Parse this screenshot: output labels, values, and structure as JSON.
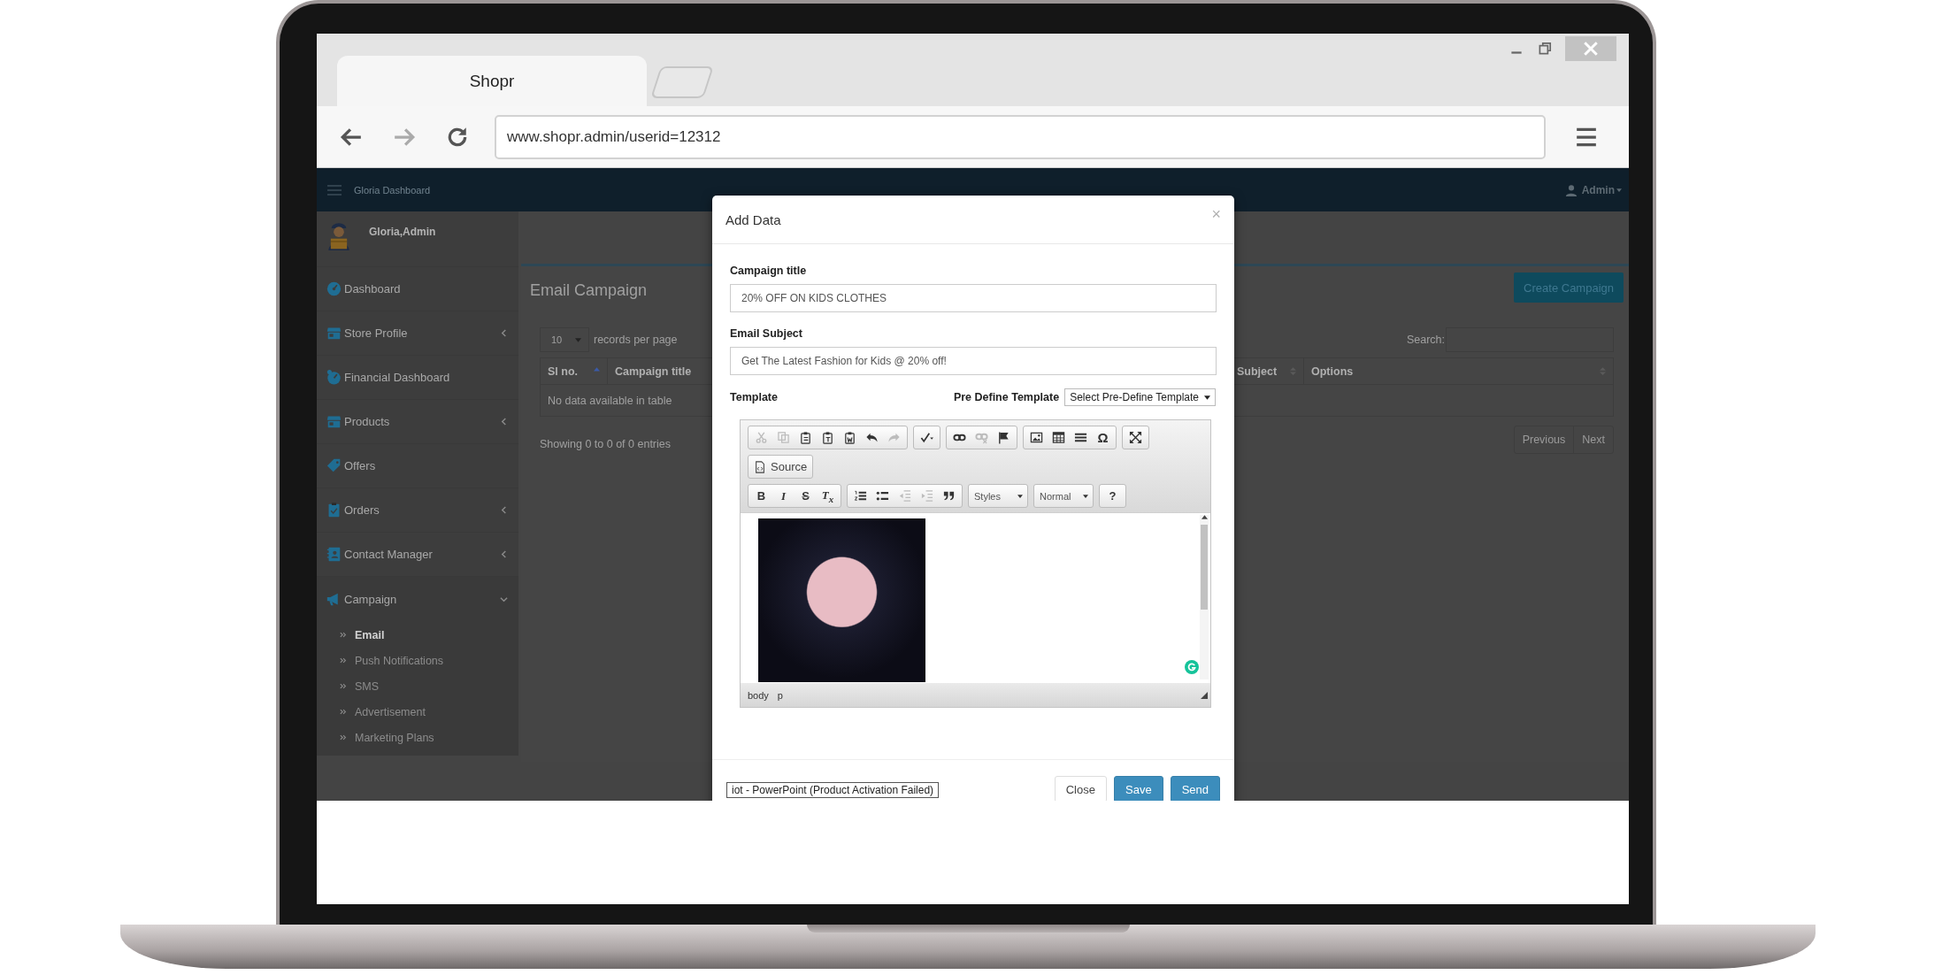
{
  "browser": {
    "tab": {
      "title": "Shopr"
    },
    "address": "www.shopr.admin/userid=12312"
  },
  "app": {
    "navbar": {
      "brand": "Gloria Dashboard",
      "user": "Admin"
    },
    "sidebar": {
      "user": "Gloria,Admin",
      "items": [
        {
          "label": "Dashboard"
        },
        {
          "label": "Store Profile",
          "expanded": false
        },
        {
          "label": "Financial Dashboard"
        },
        {
          "label": "Products",
          "expanded": false
        },
        {
          "label": "Offers"
        },
        {
          "label": "Orders",
          "expanded": false
        },
        {
          "label": "Contact Manager",
          "expanded": false
        },
        {
          "label": "Campaign",
          "expanded": true,
          "children": [
            {
              "label": "Email",
              "selected": true
            },
            {
              "label": "Push Notifications",
              "selected": false
            },
            {
              "label": "SMS",
              "selected": false
            },
            {
              "label": "Advertisement",
              "selected": false
            },
            {
              "label": "Marketing Plans",
              "selected": false
            }
          ]
        }
      ]
    },
    "page": {
      "title": "Email Campaign",
      "create_button": "Create Campaign",
      "page_size": "10",
      "page_size_label": "records per page",
      "search_label": "Search:",
      "columns": [
        {
          "label": "Sl no.",
          "sorted": true
        },
        {
          "label": "Campaign title"
        },
        {
          "label": "Subject",
          "sorted": false
        },
        {
          "label": "Options",
          "sorted": false
        }
      ],
      "empty_message": "No data available in table",
      "info": "Showing 0 to 0 of 0 entries",
      "pagination": [
        "Previous",
        "Next"
      ]
    }
  },
  "modal": {
    "title": "Add Data",
    "close_symbol": "×",
    "fields": [
      {
        "label": "Campaign title",
        "value": "20% OFF ON KIDS CLOTHES"
      },
      {
        "label": "Email Subject",
        "value": "Get The Latest Fashion for Kids @ 20% off!"
      }
    ],
    "template_label": "Template",
    "predefine_label": "Pre Define Template",
    "predefine_select": "Select Pre-Define Template",
    "editor": {
      "toolbar": [
        [
          [
            {
              "kind": "icon",
              "disabled": true
            },
            {
              "kind": "icon",
              "disabled": true
            },
            {
              "kind": "icon",
              "disabled": false
            },
            {
              "kind": "icon",
              "disabled": false
            },
            {
              "kind": "icon",
              "disabled": false
            },
            {
              "kind": "icon",
              "disabled": false
            },
            {
              "kind": "icon",
              "disabled": true
            }
          ],
          [
            {
              "kind": "icon",
              "disabled": false
            }
          ],
          [
            {
              "kind": "icon",
              "disabled": false
            },
            {
              "kind": "icon",
              "disabled": true
            },
            {
              "kind": "icon",
              "disabled": false
            }
          ],
          [
            {
              "kind": "icon",
              "disabled": false
            },
            {
              "kind": "icon",
              "disabled": false
            },
            {
              "kind": "icon",
              "disabled": false
            },
            {
              "kind": "glyph",
              "label": "Ω"
            }
          ],
          [
            {
              "kind": "icon",
              "disabled": false
            }
          ]
        ],
        [
          [
            {
              "kind": "icon-text",
              "label": "Source"
            }
          ]
        ],
        [
          [
            {
              "kind": "bold",
              "label": "B"
            },
            {
              "kind": "italic",
              "label": "I"
            },
            {
              "kind": "strike",
              "label": "S"
            },
            {
              "kind": "italic",
              "label": "T$_{x}$"
            }
          ],
          [
            {
              "kind": "icon",
              "disabled": false
            },
            {
              "kind": "icon",
              "disabled": false
            },
            {
              "kind": "icon",
              "disabled": true
            },
            {
              "kind": "icon",
              "disabled": true
            },
            {
              "kind": "icon",
              "disabled": false
            }
          ],
          [
            {
              "kind": "dropdown",
              "label": "Styles"
            }
          ],
          [
            {
              "kind": "dropdown",
              "label": "Normal"
            }
          ],
          [
            {
              "kind": "bold",
              "label": "?"
            }
          ]
        ]
      ],
      "path": [
        "body",
        "p"
      ]
    },
    "buttons": [
      {
        "label": "Close",
        "kind": "default"
      },
      {
        "label": "Save",
        "kind": "primary"
      },
      {
        "label": "Send",
        "kind": "primary"
      }
    ]
  },
  "tooltip": "iot - PowerPoint (Product Activation Failed)"
}
